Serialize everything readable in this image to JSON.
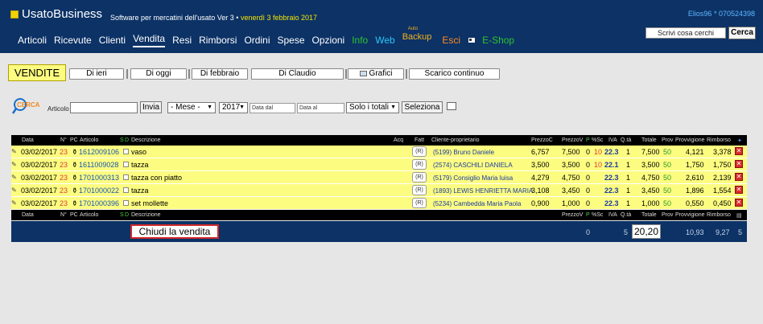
{
  "app": {
    "name": "UsatoBusiness",
    "tagline": "Software per mercatini dell'usato Ver 3 •",
    "date": "venerdì 3 febbraio 2017",
    "user": "Elios96 * 070524398"
  },
  "nav": {
    "items": [
      "Articoli",
      "Ricevute",
      "Clienti",
      "Vendita",
      "Resi",
      "Rimborsi",
      "Ordini",
      "Spese",
      "Opzioni",
      "Info",
      "Web"
    ],
    "backup_small": "Auto",
    "backup": "Backup",
    "esci": "Esci",
    "eshop": "E-Shop"
  },
  "search": {
    "placeholder": "Scrivi cosa cerchi",
    "button": "Cerca"
  },
  "toolbar": {
    "title": "VENDITE",
    "buttons": [
      "Di ieri",
      "Di oggi",
      "Di febbraio",
      "Di Claudio",
      "Grafici",
      "Scarico continuo"
    ]
  },
  "filter": {
    "articolo_label": "Articolo",
    "invia": "Invia",
    "mese": "- Mese -",
    "anno": "2017",
    "data_dal": "Data dal",
    "data_al": "Data al",
    "totali": "Solo i totali",
    "seleziona": "Seleziona"
  },
  "table": {
    "headers": {
      "data": "Data",
      "n": "N°",
      "pc": "PC",
      "articolo": "Articolo",
      "s": "S",
      "d": "D",
      "descrizione": "Descrizione",
      "acq": "Acq",
      "fatt": "Fatt",
      "cliente": "Cliente-proprietario",
      "prezzoc": "PrezzoC",
      "prezzov": "PrezzoV",
      "p": "P",
      "sc": "%Sc",
      "iva": "IVA",
      "qta": "Q.tà",
      "totale": "Totale",
      "prov": "Prov",
      "provvigione": "Provvigione",
      "rimborso": "Rimborso"
    },
    "rows": [
      {
        "data": "03/02/2017",
        "n": "23",
        "articolo": "1612009106",
        "descrizione": "vaso",
        "fatt": "(R)",
        "cliente": "(5199) Bruno Daniele",
        "prezzoc": "6,757",
        "prezzov": "7,500",
        "p": "0",
        "sc": "10",
        "iva": "22.3",
        "qta": "1",
        "totale": "7,500",
        "prov": "50",
        "provvigione": "4,121",
        "rimborso": "3,378"
      },
      {
        "data": "03/02/2017",
        "n": "23",
        "articolo": "1611009028",
        "descrizione": "tazza",
        "fatt": "(R)",
        "cliente": "(2574) CASCHILI DANIELA",
        "prezzoc": "3,500",
        "prezzov": "3,500",
        "p": "0",
        "sc": "10",
        "iva": "22.1",
        "qta": "1",
        "totale": "3,500",
        "prov": "50",
        "provvigione": "1,750",
        "rimborso": "1,750"
      },
      {
        "data": "03/02/2017",
        "n": "23",
        "articolo": "1701000313",
        "descrizione": "tazza con piatto",
        "fatt": "(R)",
        "cliente": "(5179) Consiglio Maria luisa",
        "prezzoc": "4,279",
        "prezzov": "4,750",
        "p": "0",
        "sc": "",
        "iva": "22.3",
        "qta": "1",
        "totale": "4,750",
        "prov": "50",
        "provvigione": "2,610",
        "rimborso": "2,139"
      },
      {
        "data": "03/02/2017",
        "n": "23",
        "articolo": "1701000022",
        "descrizione": "tazza",
        "fatt": "(R)",
        "cliente": "(1893) LEWIS HENRIETTA MARIA",
        "prezzoc": "3,108",
        "prezzov": "3,450",
        "p": "0",
        "sc": "",
        "iva": "22.3",
        "qta": "1",
        "totale": "3,450",
        "prov": "50",
        "provvigione": "1,896",
        "rimborso": "1,554"
      },
      {
        "data": "03/02/2017",
        "n": "23",
        "articolo": "1701000396",
        "descrizione": "set mollette",
        "fatt": "(R)",
        "cliente": "(5234) Cambedda Maria Paola",
        "prezzoc": "0,900",
        "prezzov": "1,000",
        "p": "0",
        "sc": "",
        "iva": "22.3",
        "qta": "1",
        "totale": "1,000",
        "prov": "50",
        "provvigione": "0,550",
        "rimborso": "0,450"
      }
    ]
  },
  "footer": {
    "chiudi": "Chiudi la vendita",
    "p_total": "0",
    "qta_total": "5",
    "totale": "20,20",
    "provvigione": "10,93",
    "rimborso": "9,27",
    "count": "5"
  },
  "colors": {
    "header_bg": "#0c3266",
    "row_bg": "#fcfc80",
    "accent_red": "#e53a2f"
  }
}
